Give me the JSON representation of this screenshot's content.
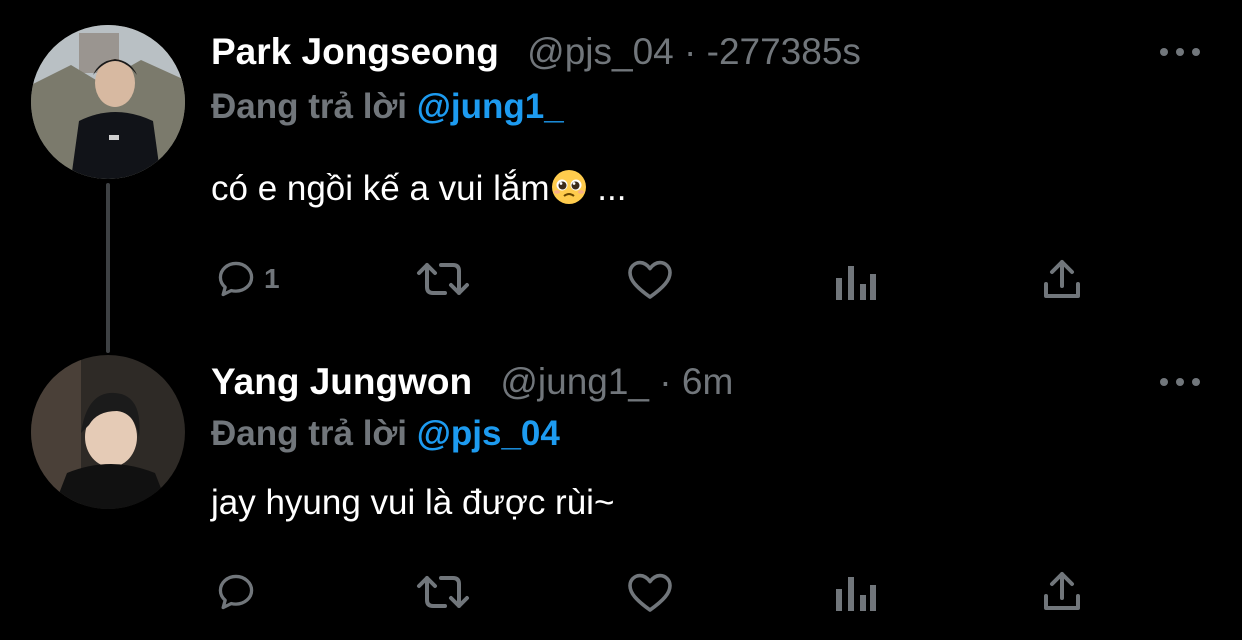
{
  "tweets": [
    {
      "name": "Park Jongseong",
      "handle": "@pjs_04",
      "separator": "·",
      "time": "-277385s",
      "reply_prefix": "Đang trả lời",
      "reply_to": "@jung1_",
      "text": "có e ngồi kế a vui lắm",
      "text_suffix": " ...",
      "emoji": "pleading-face",
      "actions": {
        "reply_count": "1"
      }
    },
    {
      "name": "Yang Jungwon",
      "handle": "@jung1_",
      "separator": "·",
      "time": "6m",
      "reply_prefix": "Đang trả lời",
      "reply_to": "@pjs_04",
      "text": "jay hyung vui là được rùi~",
      "actions": {
        "reply_count": ""
      }
    }
  ],
  "icons": [
    "reply-icon",
    "retweet-icon",
    "like-icon",
    "analytics-icon",
    "share-icon",
    "more-icon"
  ],
  "colors": {
    "background": "#000000",
    "accent": "#1d9bf0",
    "muted": "#71767b",
    "text": "#ffffff"
  }
}
